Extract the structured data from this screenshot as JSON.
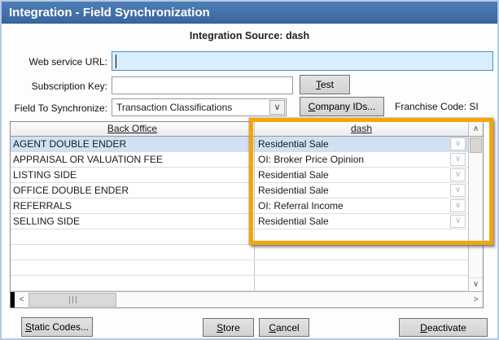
{
  "window": {
    "title": "Integration - Field Synchronization"
  },
  "header": {
    "source_label": "Integration Source: dash"
  },
  "form": {
    "web_service_url": {
      "label": "Web service URL:",
      "value": ""
    },
    "subscription_key": {
      "label": "Subscription Key:",
      "value": ""
    },
    "test_button": "Test",
    "field_to_synchronize": {
      "label": "Field To Synchronize:",
      "value": "Transaction Classifications"
    },
    "company_ids_button": "Company IDs...",
    "franchise_code": "Franchise Code: SI"
  },
  "table": {
    "columns": [
      "Back Office",
      "dash"
    ],
    "rows": [
      {
        "back_office": "AGENT DOUBLE ENDER",
        "dash": "Residential Sale",
        "selected": true
      },
      {
        "back_office": "APPRAISAL OR VALUATION FEE",
        "dash": "OI: Broker Price Opinion",
        "selected": false
      },
      {
        "back_office": "LISTING SIDE",
        "dash": "Residential Sale",
        "selected": false
      },
      {
        "back_office": "OFFICE DOUBLE ENDER",
        "dash": "Residential Sale",
        "selected": false
      },
      {
        "back_office": "REFERRALS",
        "dash": "OI: Referral Income",
        "selected": false
      },
      {
        "back_office": "SELLING SIDE",
        "dash": "Residential Sale",
        "selected": false
      }
    ],
    "empty_row_count": 4
  },
  "footer": {
    "static_codes_button": "Static Codes...",
    "store_button": "Store",
    "cancel_button": "Cancel",
    "deactivate_button": "Deactivate"
  },
  "icons": {
    "chevron_down": "∨",
    "chevron_up": "∧",
    "chevron_left": "<",
    "chevron_right": ">"
  },
  "colors": {
    "titlebar": "#3d6ba6",
    "titlebar_text": "#ffffff",
    "highlight_box": "#f2a60d",
    "selected_row": "#cfe1f3",
    "focused_input_bg": "#d9edfc",
    "focused_input_border": "#4a90c4"
  }
}
